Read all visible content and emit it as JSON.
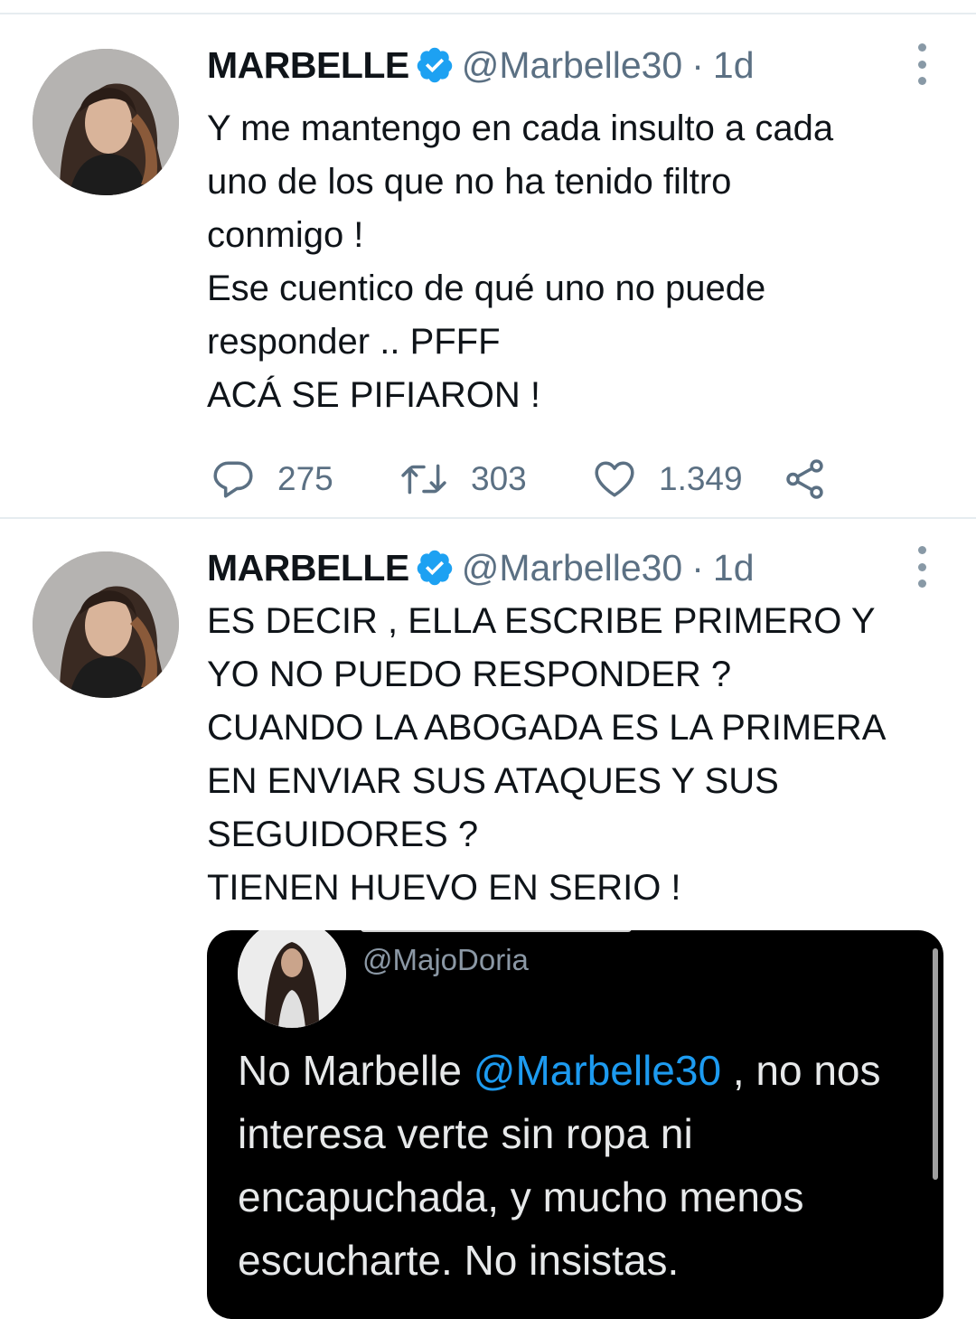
{
  "tweets": [
    {
      "name": "MARBELLE",
      "handle": "@Marbelle30",
      "separator": "·",
      "time": "1d",
      "lines": [
        "Y me mantengo en cada insulto a cada",
        "uno de los que no ha tenido filtro",
        "conmigo !",
        "Ese cuentico de qué uno no puede",
        "responder .. PFFF",
        "ACÁ SE PIFIARON !"
      ],
      "replies": "275",
      "retweets": "303",
      "likes": "1.349"
    },
    {
      "name": "MARBELLE",
      "handle": "@Marbelle30",
      "separator": "·",
      "time": "1d",
      "lines": [
        "ES DECIR , ELLA ESCRIBE PRIMERO Y",
        "YO NO PUEDO RESPONDER ?",
        "CUANDO LA ABOGADA ES LA PRIMERA",
        "EN ENVIAR SUS ATAQUES Y SUS",
        "SEGUIDORES ?",
        "TIENEN HUEVO EN SERIO !"
      ],
      "quoted": {
        "handle": "@MajoDoria",
        "text_start": "No Marbelle ",
        "mention": "@Marbelle30",
        "text_after_mention": " , no nos",
        "lines": [
          "interesa verte sin ropa ni",
          "encapuchada, y mucho menos",
          "escucharte. No insistas."
        ]
      }
    }
  ],
  "icons": {
    "verified": "verified-badge-icon",
    "reply": "reply-icon",
    "retweet": "retweet-icon",
    "like": "heart-icon",
    "share": "share-icon",
    "more": "more-vertical-icon"
  },
  "colors": {
    "verified": "#1da1f2",
    "secondary_text": "#5b7083",
    "divider": "#e6ecf0",
    "mention": "#1d9bf0"
  }
}
